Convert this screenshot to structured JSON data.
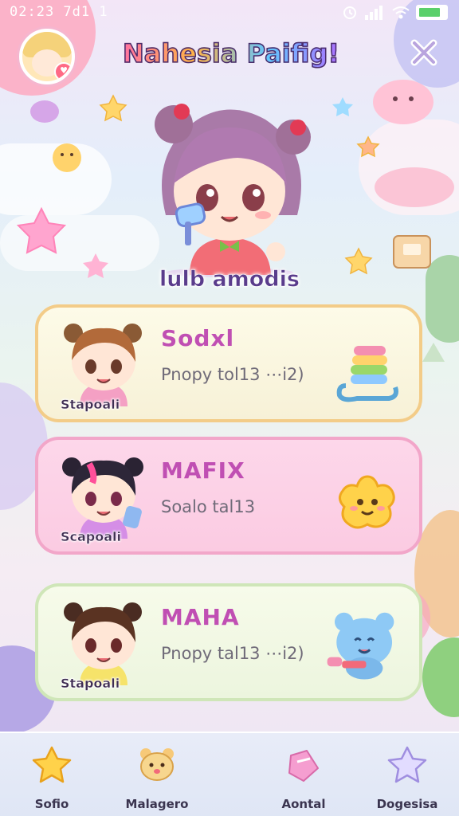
{
  "status_bar": {
    "time": "02:23 7d1 1",
    "battery_color": "#5ad06a"
  },
  "header": {
    "title": "Nahesia Paifig!",
    "profile_badge": "♥"
  },
  "hero": {
    "name": "lulb amodis"
  },
  "cards": [
    {
      "name": "Sodxl",
      "description": "Pnopy tol13 ⋯i2)",
      "tag": "Stapoali",
      "item_icon": "rainbow-toy-icon",
      "accent": "#f3cc88"
    },
    {
      "name": "MAFIX",
      "description": "Soalo tal13",
      "tag": "Scapoali",
      "item_icon": "star-face-icon",
      "accent": "#f2a6c9"
    },
    {
      "name": "MAHA",
      "description": "Pnopy tal13 ⋯i2)",
      "tag": "Stapoali",
      "item_icon": "blue-bear-icon",
      "accent": "#cfe6b8"
    }
  ],
  "nav": [
    {
      "label": "Sofio",
      "icon": "star-icon"
    },
    {
      "label": "Malagero",
      "icon": "bear-icon"
    },
    {
      "label": "Aontal",
      "icon": "ribbon-icon"
    },
    {
      "label": "Dogesisa",
      "icon": "star-outline-icon"
    }
  ]
}
